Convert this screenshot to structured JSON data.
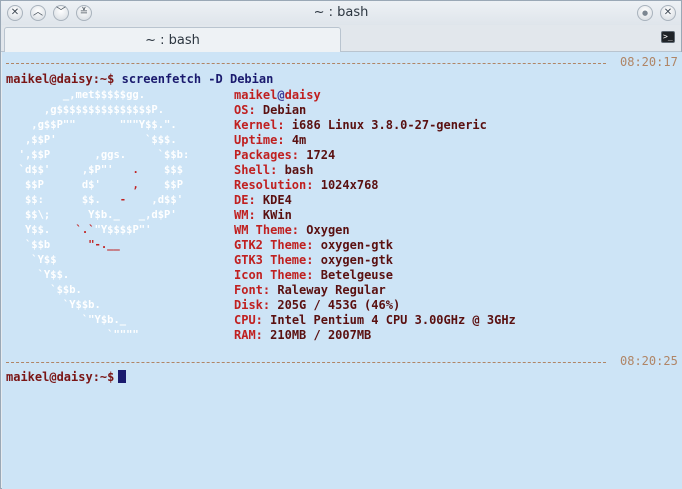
{
  "window": {
    "title": "~ : bash",
    "buttons": {
      "close": "✕",
      "collapse": "︿",
      "expand": "﹀",
      "minimize": "≚",
      "menu": "●"
    }
  },
  "tabs": [
    {
      "label": "~ : bash",
      "icon": "terminal-icon"
    }
  ],
  "terminal": {
    "icon_glyph": ">_",
    "top_timestamp": "08:20:17",
    "prompt1": "maikel@daisy:~$",
    "command": "screenfetch -D Debian",
    "logo_name": "debian-swirl-ascii",
    "bottom_timestamp": "08:20:25",
    "prompt2": "maikel@daisy:~$",
    "colors": {
      "background": "#cde4f6",
      "separator": "#b08566",
      "key": "#c02020",
      "value": "#5a1010",
      "command": "#1a1a6e"
    }
  },
  "fetch": {
    "user": "maikel",
    "at": "@",
    "host": "daisy",
    "rows": [
      {
        "key": "OS:",
        "value": "Debian"
      },
      {
        "key": "Kernel:",
        "value": "i686 Linux 3.8.0-27-generic"
      },
      {
        "key": "Uptime:",
        "value": "4m"
      },
      {
        "key": "Packages:",
        "value": "1724"
      },
      {
        "key": "Shell:",
        "value": "bash"
      },
      {
        "key": "Resolution:",
        "value": "1024x768"
      },
      {
        "key": "DE:",
        "value": "KDE4"
      },
      {
        "key": "WM:",
        "value": "KWin"
      },
      {
        "key": "WM Theme:",
        "value": "Oxygen"
      },
      {
        "key": "GTK2 Theme:",
        "value": "oxygen-gtk"
      },
      {
        "key": "GTK3 Theme:",
        "value": "oxygen-gtk"
      },
      {
        "key": "Icon Theme:",
        "value": "Betelgeuse"
      },
      {
        "key": "Font:",
        "value": "Raleway Regular"
      },
      {
        "key": "Disk:",
        "value": "205G / 453G (46%)"
      },
      {
        "key": "CPU:",
        "value": "Intel Pentium 4 CPU 3.00GHz @ 3GHz"
      },
      {
        "key": "RAM:",
        "value": "210MB / 2007MB"
      }
    ]
  },
  "logo_lines": [
    "         _,met$$$$$gg.",
    "      ,g$$$$$$$$$$$$$$$P.",
    "    ,g$$P\"\"       \"\"\"Y$$.\".",
    "   ,$$P'              `$$$.",
    "  ',$$P       ,ggs.     `$$b:",
    "  `d$$'     ,$P\"'   .    $$$",
    "   $$P      d$'     ,    $$P",
    "   $$:      $$.   -    ,d$$'",
    "   $$\\;      Y$b._   _,d$P'",
    "   Y$$.    `.`\"Y$$$$P\"'",
    "   `$$b      \"-.__",
    "    `Y$$",
    "     `Y$$.",
    "       `$$b.",
    "         `Y$$b.",
    "            `\"Y$b._",
    "                `\"\"\"\""
  ]
}
